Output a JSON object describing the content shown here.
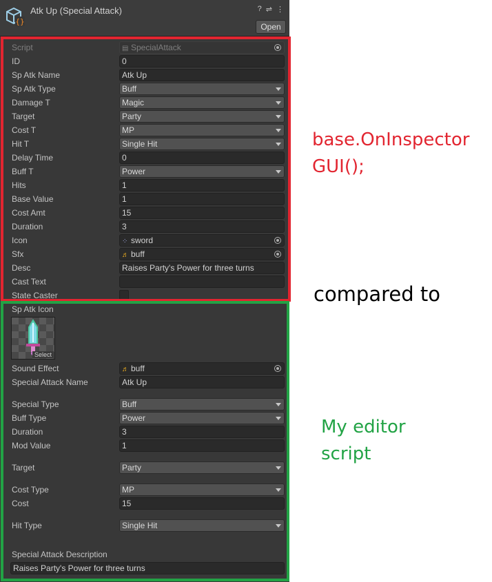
{
  "header": {
    "title": "Atk Up (Special Attack)",
    "open_label": "Open",
    "icons": [
      "help-icon",
      "settings-sliders-icon",
      "kebab-menu-icon"
    ]
  },
  "default_inspector": {
    "rows": [
      {
        "label": "Script",
        "kind": "object",
        "value": "SpecialAttack",
        "disabled": true
      },
      {
        "label": "ID",
        "kind": "field",
        "value": "0"
      },
      {
        "label": "Sp Atk Name",
        "kind": "field",
        "value": "Atk Up"
      },
      {
        "label": "Sp Atk Type",
        "kind": "dropdown",
        "value": "Buff"
      },
      {
        "label": "Damage T",
        "kind": "dropdown",
        "value": "Magic"
      },
      {
        "label": "Target",
        "kind": "dropdown",
        "value": "Party"
      },
      {
        "label": "Cost T",
        "kind": "dropdown",
        "value": "MP"
      },
      {
        "label": "Hit T",
        "kind": "dropdown",
        "value": "Single Hit"
      },
      {
        "label": "Delay Time",
        "kind": "field",
        "value": "0"
      },
      {
        "label": "Buff T",
        "kind": "dropdown",
        "value": "Power"
      },
      {
        "label": "Hits",
        "kind": "field",
        "value": "1"
      },
      {
        "label": "Base Value",
        "kind": "field",
        "value": "1"
      },
      {
        "label": "Cost Amt",
        "kind": "field",
        "value": "15"
      },
      {
        "label": "Duration",
        "kind": "field",
        "value": "3"
      },
      {
        "label": "Icon",
        "kind": "object",
        "value": "sword",
        "icon": "sprite-icon"
      },
      {
        "label": "Sfx",
        "kind": "object",
        "value": "buff",
        "icon": "audio-clip-icon"
      },
      {
        "label": "Desc",
        "kind": "field",
        "value": "Raises Party's Power for three turns"
      },
      {
        "label": "Cast Text",
        "kind": "field",
        "value": ""
      },
      {
        "label": "State Caster",
        "kind": "checkbox",
        "value": ""
      }
    ]
  },
  "custom_editor": {
    "sprite_label": "Sp Atk Icon",
    "sprite_select": "Select",
    "rows": [
      {
        "label": "Sound Effect",
        "kind": "object",
        "value": "buff",
        "icon": "audio-clip-icon"
      },
      {
        "label": "Special Attack Name",
        "kind": "field",
        "value": "Atk Up"
      },
      {
        "label": "Special Type",
        "kind": "dropdown",
        "value": "Buff"
      },
      {
        "label": "Buff Type",
        "kind": "dropdown",
        "value": "Power"
      },
      {
        "label": "Duration",
        "kind": "field",
        "value": "3"
      },
      {
        "label": "Mod Value",
        "kind": "field",
        "value": "1"
      },
      {
        "label": "Target",
        "kind": "dropdown",
        "value": "Party"
      },
      {
        "label": "Cost Type",
        "kind": "dropdown",
        "value": "MP"
      },
      {
        "label": "Cost",
        "kind": "field",
        "value": "15"
      },
      {
        "label": "Hit Type",
        "kind": "dropdown",
        "value": "Single Hit"
      }
    ],
    "description_label": "Special Attack Description",
    "description_value": "Raises Party's Power for three turns"
  },
  "annotations": {
    "red": "base.OnInspector\nGUI();",
    "black": "compared to",
    "green": "My editor\nscript"
  },
  "colors": {
    "red_box": "#e22530",
    "green_box": "#22a345",
    "panel_bg": "#383838"
  }
}
